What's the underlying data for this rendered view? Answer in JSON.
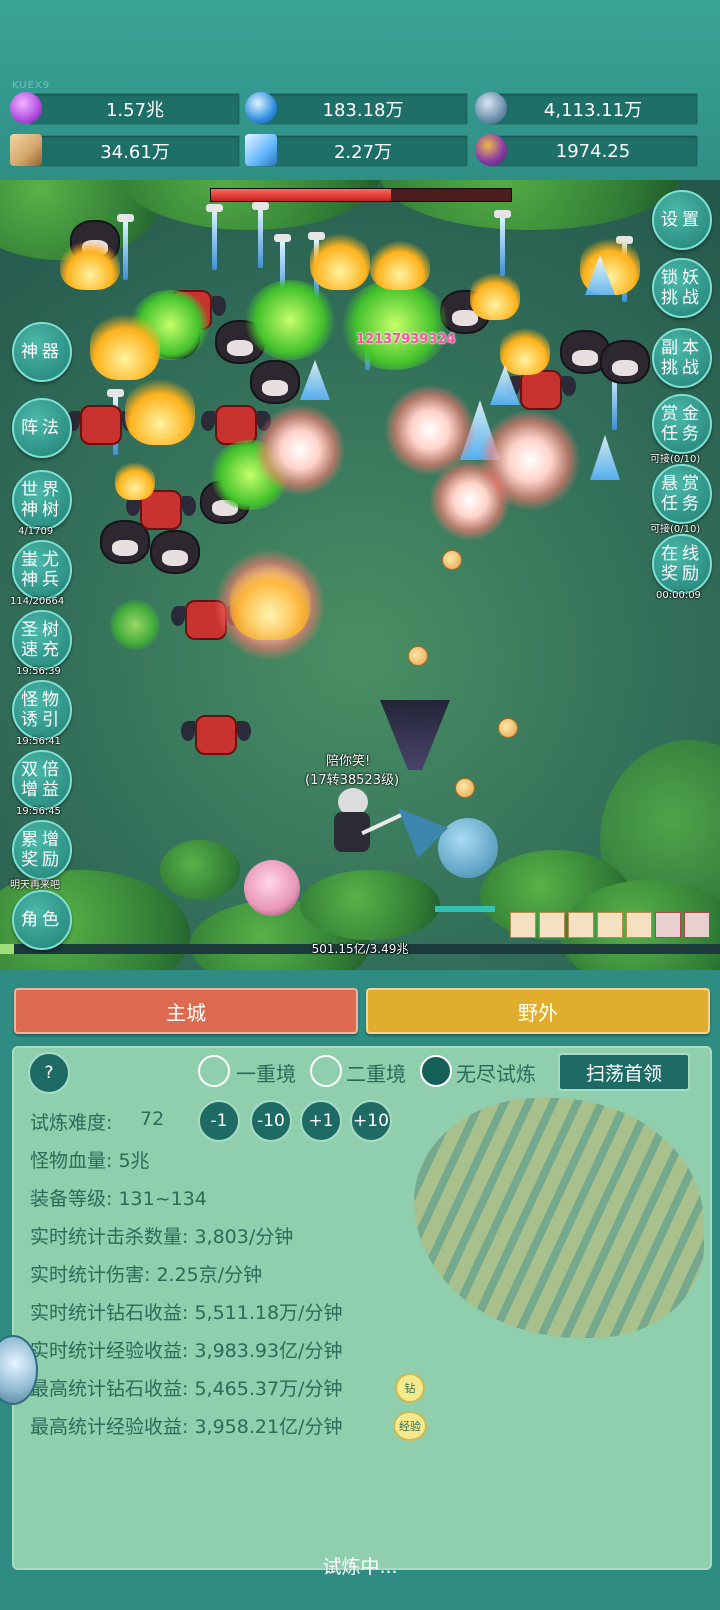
{
  "top": {
    "uid": "KUEX9",
    "resources": [
      {
        "icon": "purple-gem-icon",
        "value": "1.57兆",
        "color": "#b04de0"
      },
      {
        "icon": "blue-diamond-icon",
        "value": "183.18万",
        "color": "#2f8ee0"
      },
      {
        "icon": "orb-icon",
        "value": "4,113.11万",
        "color": "#6a8fae"
      },
      {
        "icon": "scroll-icon",
        "value": "34.61万",
        "color": "#d2a46b"
      },
      {
        "icon": "ice-crystal-icon",
        "value": "2.27万",
        "color": "#64b8ff"
      },
      {
        "icon": "treasure-pot-icon",
        "value": "1974.25",
        "color": "#8a3fa6"
      }
    ]
  },
  "battle": {
    "boss_hp_fraction": 0.6,
    "damage_number": "12137939324",
    "player_name": "陪你笑!",
    "player_level": "(17转38523级)",
    "exp_text": "501.15亿/3.49兆",
    "left_buttons": [
      {
        "label": "神器",
        "sub": ""
      },
      {
        "label": "阵法",
        "sub": ""
      },
      {
        "label": "世界神树",
        "sub": "4/1709"
      },
      {
        "label": "蚩尤神兵",
        "sub": "114/20664"
      },
      {
        "label": "圣树速充",
        "sub": "19:56:39"
      },
      {
        "label": "怪物诱引",
        "sub": "19:56:41"
      },
      {
        "label": "双倍增益",
        "sub": "19:56:45"
      },
      {
        "label": "累增奖励",
        "sub": "明天再来吧"
      },
      {
        "label": "角色",
        "sub": ""
      }
    ],
    "right_buttons": [
      {
        "label": "设置",
        "sub": ""
      },
      {
        "label": "锁妖挑战",
        "sub": ""
      },
      {
        "label": "副本挑战",
        "sub": ""
      },
      {
        "label": "赏金任务",
        "sub": "可接(0/10)"
      },
      {
        "label": "悬赏任务",
        "sub": "可接(0/10)"
      },
      {
        "label": "在线奖励",
        "sub": "00:00:09"
      }
    ]
  },
  "tabs": {
    "main_city": "主城",
    "wild": "野外"
  },
  "panel": {
    "help": "?",
    "modes": [
      {
        "label": "一重境",
        "selected": false
      },
      {
        "label": "二重境",
        "selected": false
      },
      {
        "label": "无尽试炼",
        "selected": true
      }
    ],
    "sweep_button": "扫荡首领",
    "difficulty_label": "试炼难度:",
    "difficulty_value": "72",
    "adjust_buttons": [
      "-1",
      "-10",
      "+1",
      "+10"
    ],
    "stats": [
      "怪物血量: 5兆",
      "装备等级: 131~134",
      "实时统计击杀数量: 3,803/分钟",
      "实时统计伤害: 2.25京/分钟",
      "实时统计钻石收益: 5,511.18万/分钟",
      "实时统计经验收益: 3,983.93亿/分钟",
      "最高统计钻石收益: 5,465.37万/分钟",
      "最高统计经验收益: 3,958.21亿/分钟"
    ],
    "badge_diamond": "钻",
    "badge_exp": "经验",
    "status": "试炼中..."
  }
}
